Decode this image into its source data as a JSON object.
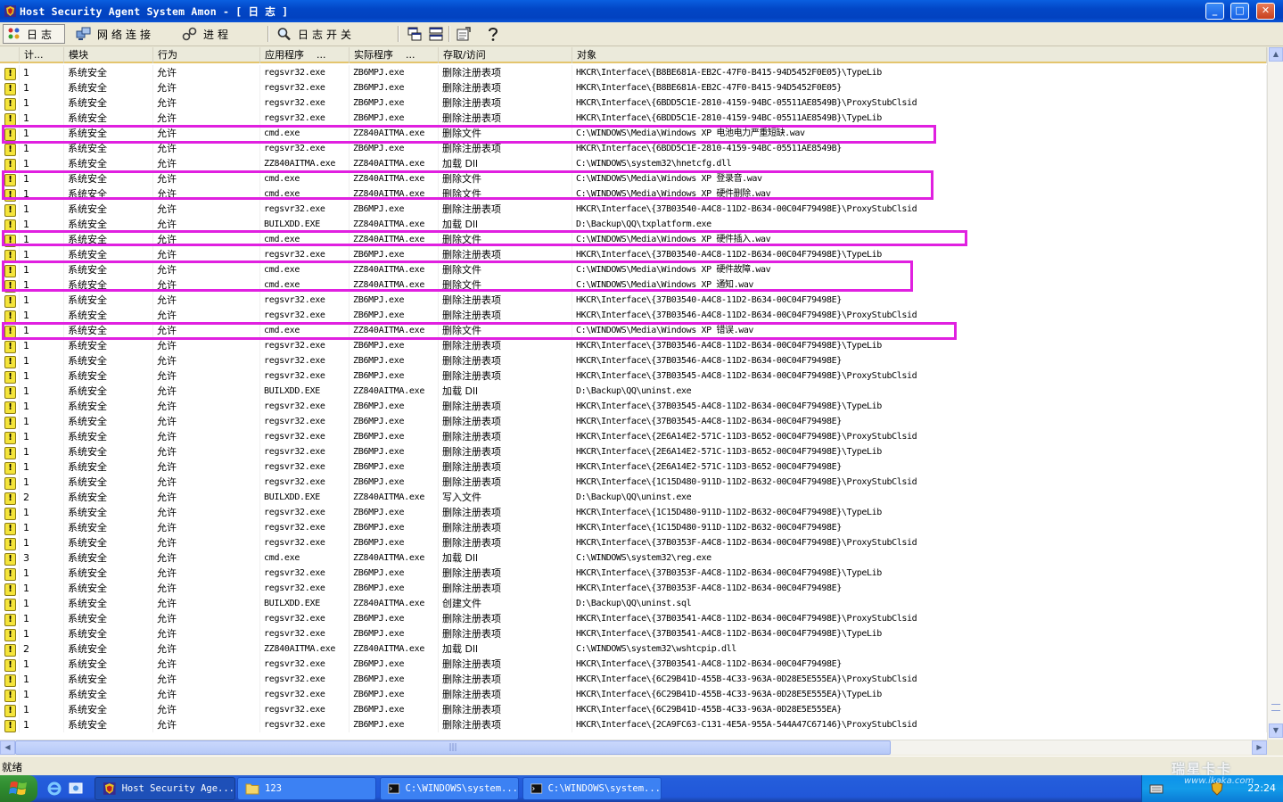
{
  "window": {
    "title": "Host Security Agent System Amon - [ 日 志  ]",
    "min_label": "_",
    "max_label": "□",
    "close_label": "✕"
  },
  "toolbar": {
    "log_label": "日志",
    "network_label": "网络连接",
    "process_label": "进程",
    "log_switch_label": "日志开关"
  },
  "columns": [
    "计...",
    "模块",
    "行为",
    "应用程序",
    "实际程序",
    "存取/访问",
    "对象"
  ],
  "column_suffix": "...",
  "rows": [
    [
      "1",
      "系统安全",
      "允许",
      "regsvr32.exe",
      "ZB6MPJ.exe",
      "删除注册表项",
      "HKCR\\Interface\\{B8BE681A-EB2C-47F0-B415-94D5452F0E05}\\TypeLib"
    ],
    [
      "1",
      "系统安全",
      "允许",
      "regsvr32.exe",
      "ZB6MPJ.exe",
      "删除注册表项",
      "HKCR\\Interface\\{B8BE681A-EB2C-47F0-B415-94D5452F0E05}"
    ],
    [
      "1",
      "系统安全",
      "允许",
      "regsvr32.exe",
      "ZB6MPJ.exe",
      "删除注册表项",
      "HKCR\\Interface\\{6BDD5C1E-2810-4159-94BC-05511AE8549B}\\ProxyStubClsid"
    ],
    [
      "1",
      "系统安全",
      "允许",
      "regsvr32.exe",
      "ZB6MPJ.exe",
      "删除注册表项",
      "HKCR\\Interface\\{6BDD5C1E-2810-4159-94BC-05511AE8549B}\\TypeLib"
    ],
    [
      "1",
      "系统安全",
      "允许",
      "cmd.exe",
      "ZZ840AITMA.exe",
      "删除文件",
      "C:\\WINDOWS\\Media\\Windows XP 电池电力严重短缺.wav"
    ],
    [
      "1",
      "系统安全",
      "允许",
      "regsvr32.exe",
      "ZB6MPJ.exe",
      "删除注册表项",
      "HKCR\\Interface\\{6BDD5C1E-2810-4159-94BC-05511AE8549B}"
    ],
    [
      "1",
      "系统安全",
      "允许",
      "ZZ840AITMA.exe",
      "ZZ840AITMA.exe",
      "加载 Dll",
      "C:\\WINDOWS\\system32\\hnetcfg.dll"
    ],
    [
      "1",
      "系统安全",
      "允许",
      "cmd.exe",
      "ZZ840AITMA.exe",
      "删除文件",
      "C:\\WINDOWS\\Media\\Windows XP 登录音.wav"
    ],
    [
      "1",
      "系统安全",
      "允许",
      "cmd.exe",
      "ZZ840AITMA.exe",
      "删除文件",
      "C:\\WINDOWS\\Media\\Windows XP 硬件删除.wav"
    ],
    [
      "1",
      "系统安全",
      "允许",
      "regsvr32.exe",
      "ZB6MPJ.exe",
      "删除注册表项",
      "HKCR\\Interface\\{37B03540-A4C8-11D2-B634-00C04F79498E}\\ProxyStubClsid"
    ],
    [
      "1",
      "系统安全",
      "允许",
      "BUILXDD.EXE",
      "ZZ840AITMA.exe",
      "加载 Dll",
      "D:\\Backup\\QQ\\txplatform.exe"
    ],
    [
      "1",
      "系统安全",
      "允许",
      "cmd.exe",
      "ZZ840AITMA.exe",
      "删除文件",
      "C:\\WINDOWS\\Media\\Windows XP 硬件插入.wav"
    ],
    [
      "1",
      "系统安全",
      "允许",
      "regsvr32.exe",
      "ZB6MPJ.exe",
      "删除注册表项",
      "HKCR\\Interface\\{37B03540-A4C8-11D2-B634-00C04F79498E}\\TypeLib"
    ],
    [
      "1",
      "系统安全",
      "允许",
      "cmd.exe",
      "ZZ840AITMA.exe",
      "删除文件",
      "C:\\WINDOWS\\Media\\Windows XP 硬件故障.wav"
    ],
    [
      "1",
      "系统安全",
      "允许",
      "cmd.exe",
      "ZZ840AITMA.exe",
      "删除文件",
      "C:\\WINDOWS\\Media\\Windows XP 通知.wav"
    ],
    [
      "1",
      "系统安全",
      "允许",
      "regsvr32.exe",
      "ZB6MPJ.exe",
      "删除注册表项",
      "HKCR\\Interface\\{37B03540-A4C8-11D2-B634-00C04F79498E}"
    ],
    [
      "1",
      "系统安全",
      "允许",
      "regsvr32.exe",
      "ZB6MPJ.exe",
      "删除注册表项",
      "HKCR\\Interface\\{37B03546-A4C8-11D2-B634-00C04F79498E}\\ProxyStubClsid"
    ],
    [
      "1",
      "系统安全",
      "允许",
      "cmd.exe",
      "ZZ840AITMA.exe",
      "删除文件",
      "C:\\WINDOWS\\Media\\Windows XP 错误.wav"
    ],
    [
      "1",
      "系统安全",
      "允许",
      "regsvr32.exe",
      "ZB6MPJ.exe",
      "删除注册表项",
      "HKCR\\Interface\\{37B03546-A4C8-11D2-B634-00C04F79498E}\\TypeLib"
    ],
    [
      "1",
      "系统安全",
      "允许",
      "regsvr32.exe",
      "ZB6MPJ.exe",
      "删除注册表项",
      "HKCR\\Interface\\{37B03546-A4C8-11D2-B634-00C04F79498E}"
    ],
    [
      "1",
      "系统安全",
      "允许",
      "regsvr32.exe",
      "ZB6MPJ.exe",
      "删除注册表项",
      "HKCR\\Interface\\{37B03545-A4C8-11D2-B634-00C04F79498E}\\ProxyStubClsid"
    ],
    [
      "1",
      "系统安全",
      "允许",
      "BUILXDD.EXE",
      "ZZ840AITMA.exe",
      "加载 Dll",
      "D:\\Backup\\QQ\\uninst.exe"
    ],
    [
      "1",
      "系统安全",
      "允许",
      "regsvr32.exe",
      "ZB6MPJ.exe",
      "删除注册表项",
      "HKCR\\Interface\\{37B03545-A4C8-11D2-B634-00C04F79498E}\\TypeLib"
    ],
    [
      "1",
      "系统安全",
      "允许",
      "regsvr32.exe",
      "ZB6MPJ.exe",
      "删除注册表项",
      "HKCR\\Interface\\{37B03545-A4C8-11D2-B634-00C04F79498E}"
    ],
    [
      "1",
      "系统安全",
      "允许",
      "regsvr32.exe",
      "ZB6MPJ.exe",
      "删除注册表项",
      "HKCR\\Interface\\{2E6A14E2-571C-11D3-B652-00C04F79498E}\\ProxyStubClsid"
    ],
    [
      "1",
      "系统安全",
      "允许",
      "regsvr32.exe",
      "ZB6MPJ.exe",
      "删除注册表项",
      "HKCR\\Interface\\{2E6A14E2-571C-11D3-B652-00C04F79498E}\\TypeLib"
    ],
    [
      "1",
      "系统安全",
      "允许",
      "regsvr32.exe",
      "ZB6MPJ.exe",
      "删除注册表项",
      "HKCR\\Interface\\{2E6A14E2-571C-11D3-B652-00C04F79498E}"
    ],
    [
      "1",
      "系统安全",
      "允许",
      "regsvr32.exe",
      "ZB6MPJ.exe",
      "删除注册表项",
      "HKCR\\Interface\\{1C15D480-911D-11D2-B632-00C04F79498E}\\ProxyStubClsid"
    ],
    [
      "2",
      "系统安全",
      "允许",
      "BUILXDD.EXE",
      "ZZ840AITMA.exe",
      "写入文件",
      "D:\\Backup\\QQ\\uninst.exe"
    ],
    [
      "1",
      "系统安全",
      "允许",
      "regsvr32.exe",
      "ZB6MPJ.exe",
      "删除注册表项",
      "HKCR\\Interface\\{1C15D480-911D-11D2-B632-00C04F79498E}\\TypeLib"
    ],
    [
      "1",
      "系统安全",
      "允许",
      "regsvr32.exe",
      "ZB6MPJ.exe",
      "删除注册表项",
      "HKCR\\Interface\\{1C15D480-911D-11D2-B632-00C04F79498E}"
    ],
    [
      "1",
      "系统安全",
      "允许",
      "regsvr32.exe",
      "ZB6MPJ.exe",
      "删除注册表项",
      "HKCR\\Interface\\{37B0353F-A4C8-11D2-B634-00C04F79498E}\\ProxyStubClsid"
    ],
    [
      "3",
      "系统安全",
      "允许",
      "cmd.exe",
      "ZZ840AITMA.exe",
      "加载 Dll",
      "C:\\WINDOWS\\system32\\reg.exe"
    ],
    [
      "1",
      "系统安全",
      "允许",
      "regsvr32.exe",
      "ZB6MPJ.exe",
      "删除注册表项",
      "HKCR\\Interface\\{37B0353F-A4C8-11D2-B634-00C04F79498E}\\TypeLib"
    ],
    [
      "1",
      "系统安全",
      "允许",
      "regsvr32.exe",
      "ZB6MPJ.exe",
      "删除注册表项",
      "HKCR\\Interface\\{37B0353F-A4C8-11D2-B634-00C04F79498E}"
    ],
    [
      "1",
      "系统安全",
      "允许",
      "BUILXDD.EXE",
      "ZZ840AITMA.exe",
      "创建文件",
      "D:\\Backup\\QQ\\uninst.sql"
    ],
    [
      "1",
      "系统安全",
      "允许",
      "regsvr32.exe",
      "ZB6MPJ.exe",
      "删除注册表项",
      "HKCR\\Interface\\{37B03541-A4C8-11D2-B634-00C04F79498E}\\ProxyStubClsid"
    ],
    [
      "1",
      "系统安全",
      "允许",
      "regsvr32.exe",
      "ZB6MPJ.exe",
      "删除注册表项",
      "HKCR\\Interface\\{37B03541-A4C8-11D2-B634-00C04F79498E}\\TypeLib"
    ],
    [
      "2",
      "系统安全",
      "允许",
      "ZZ840AITMA.exe",
      "ZZ840AITMA.exe",
      "加载 Dll",
      "C:\\WINDOWS\\system32\\wshtcpip.dll"
    ],
    [
      "1",
      "系统安全",
      "允许",
      "regsvr32.exe",
      "ZB6MPJ.exe",
      "删除注册表项",
      "HKCR\\Interface\\{37B03541-A4C8-11D2-B634-00C04F79498E}"
    ],
    [
      "1",
      "系统安全",
      "允许",
      "regsvr32.exe",
      "ZB6MPJ.exe",
      "删除注册表项",
      "HKCR\\Interface\\{6C29B41D-455B-4C33-963A-0D28E5E555EA}\\ProxyStubClsid"
    ],
    [
      "1",
      "系统安全",
      "允许",
      "regsvr32.exe",
      "ZB6MPJ.exe",
      "删除注册表项",
      "HKCR\\Interface\\{6C29B41D-455B-4C33-963A-0D28E5E555EA}\\TypeLib"
    ],
    [
      "1",
      "系统安全",
      "允许",
      "regsvr32.exe",
      "ZB6MPJ.exe",
      "删除注册表项",
      "HKCR\\Interface\\{6C29B41D-455B-4C33-963A-0D28E5E555EA}"
    ],
    [
      "1",
      "系统安全",
      "允许",
      "regsvr32.exe",
      "ZB6MPJ.exe",
      "删除注册表项",
      "HKCR\\Interface\\{2CA9FC63-C131-4E5A-955A-544A47C67146}\\ProxyStubClsid"
    ]
  ],
  "row_icon": "warning-icon",
  "row_icon_glyph": "!",
  "highlight_color": "#E020E0",
  "status": {
    "text": "就绪"
  },
  "taskbar": {
    "tasks": [
      {
        "label": "Host Security Age...",
        "icon": "shield-app-icon"
      },
      {
        "label": "123",
        "icon": "folder-icon"
      },
      {
        "label": "C:\\WINDOWS\\system...",
        "icon": "console-icon"
      },
      {
        "label": "C:\\WINDOWS\\system...",
        "icon": "console-icon"
      }
    ],
    "clock": "22:24"
  },
  "watermark": {
    "line1": "瑞星卡卡",
    "line2": "www.ikaka.com"
  }
}
